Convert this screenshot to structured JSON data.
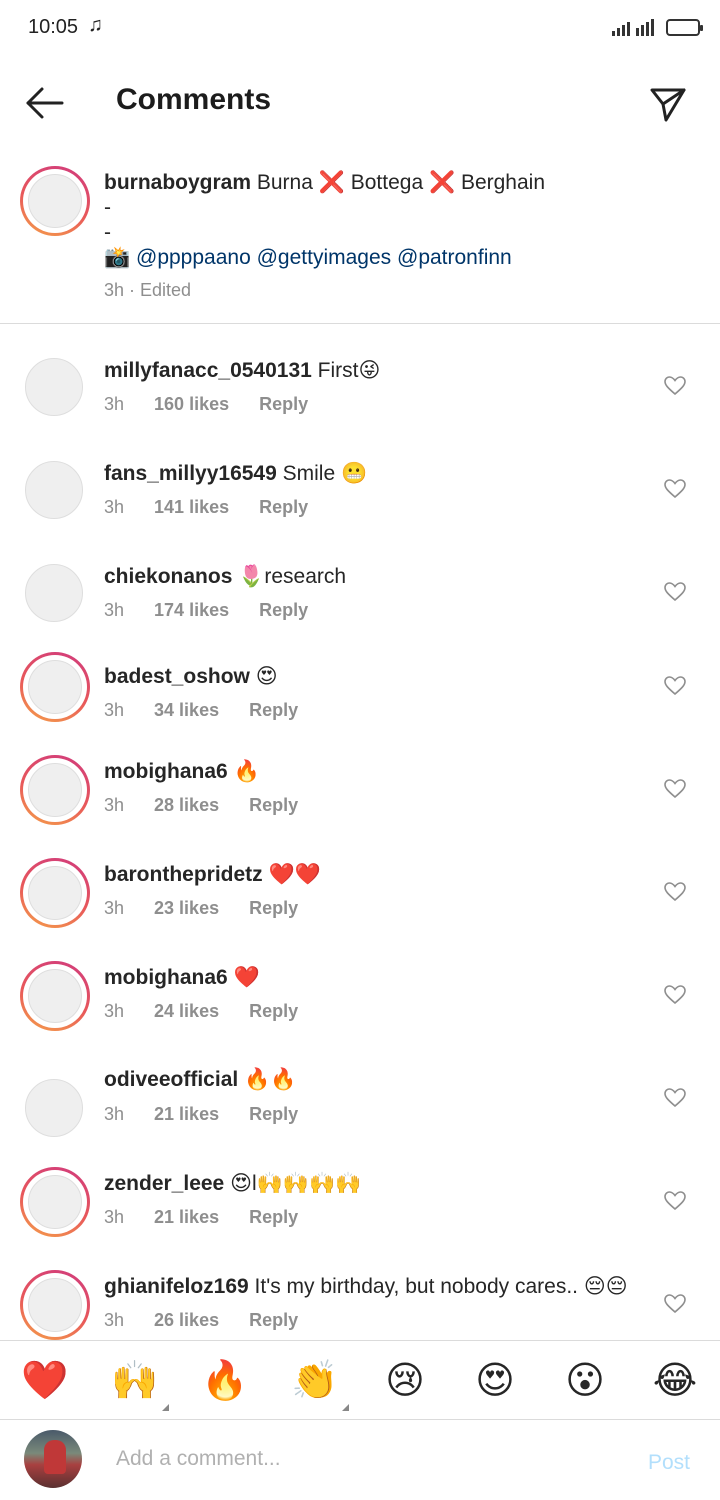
{
  "status_bar": {
    "time": "10:05",
    "note_icon": "music-note-icon"
  },
  "header": {
    "title": "Comments",
    "back_icon": "arrow-left-icon",
    "share_icon": "paper-plane-icon"
  },
  "caption": {
    "username": "burnaboygram",
    "text": "Burna ❌ Bottega ❌ Berghain",
    "dash1": "-",
    "dash2": "-",
    "camera": "📸",
    "mention1": "@ppppaano",
    "mention2": "@gettyimages",
    "mention3": "@patronfinn",
    "meta": "3h · Edited"
  },
  "comments": [
    {
      "username": "millyfanacc_0540131",
      "text": "First😜",
      "time": "3h",
      "likes": "160 likes",
      "reply": "Reply"
    },
    {
      "username": "fans_millyy16549",
      "text": "Smile 😬",
      "time": "3h",
      "likes": "141 likes",
      "reply": "Reply"
    },
    {
      "username": "chiekonanos",
      "text": "🌷research",
      "time": "3h",
      "likes": "174 likes",
      "reply": "Reply"
    },
    {
      "username": "badest_oshow",
      "text": "😍",
      "time": "3h",
      "likes": "34 likes",
      "reply": "Reply"
    },
    {
      "username": "mobighana6",
      "text": "🔥",
      "time": "3h",
      "likes": "28 likes",
      "reply": "Reply"
    },
    {
      "username": "baronthepridetz",
      "text": "❤️❤️",
      "time": "3h",
      "likes": "23 likes",
      "reply": "Reply"
    },
    {
      "username": "mobighana6",
      "text": "❤️",
      "time": "3h",
      "likes": "24 likes",
      "reply": "Reply"
    },
    {
      "username": "odiveeofficial",
      "text": "🔥🔥",
      "time": "3h",
      "likes": "21 likes",
      "reply": "Reply"
    },
    {
      "username": "zender_leee",
      "text": "😍l🙌🙌🙌🙌",
      "time": "3h",
      "likes": "21 likes",
      "reply": "Reply"
    },
    {
      "username": "ghianifeloz169",
      "text": "It's my birthday, but nobody cares.. 😔😔",
      "time": "3h",
      "likes": "26 likes",
      "reply": "Reply"
    }
  ],
  "emoji_bar": [
    "❤️",
    "🙌",
    "🔥",
    "👏",
    "😢",
    "😍",
    "😮",
    "😂"
  ],
  "input": {
    "placeholder": "Add a comment...",
    "post_label": "Post"
  },
  "colors": {
    "mention": "#003569",
    "meta_gray": "#8e8e8e",
    "post_disabled": "#b2dffc"
  }
}
